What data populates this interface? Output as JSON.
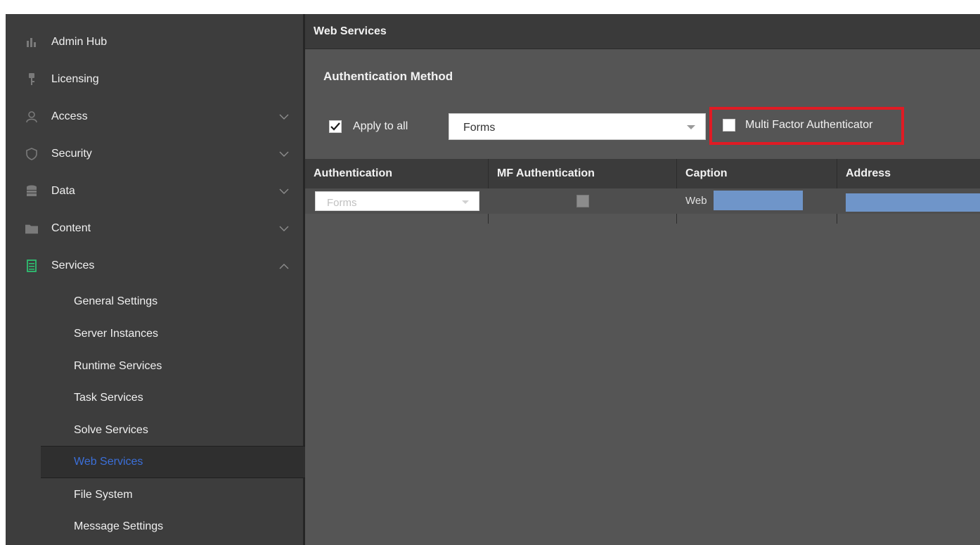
{
  "sidebar": {
    "items": [
      {
        "label": "Admin Hub",
        "icon": "admin-hub-icon"
      },
      {
        "label": "Licensing",
        "icon": "key-icon"
      },
      {
        "label": "Access",
        "icon": "user-icon",
        "expanded": false
      },
      {
        "label": "Security",
        "icon": "shield-icon",
        "expanded": false
      },
      {
        "label": "Data",
        "icon": "database-icon",
        "expanded": false
      },
      {
        "label": "Content",
        "icon": "folder-icon",
        "expanded": false
      },
      {
        "label": "Services",
        "icon": "services-icon",
        "expanded": true
      }
    ],
    "sub_items": [
      {
        "label": "General Settings"
      },
      {
        "label": "Server Instances"
      },
      {
        "label": "Runtime Services"
      },
      {
        "label": "Task Services"
      },
      {
        "label": "Solve Services"
      },
      {
        "label": "Web Services",
        "active": true
      },
      {
        "label": "File System"
      },
      {
        "label": "Message Settings"
      }
    ]
  },
  "main": {
    "header_title": "Web Services",
    "section_title": "Authentication Method",
    "apply_to_all": {
      "label": "Apply to all",
      "checked": true
    },
    "method_select": {
      "value": "Forms"
    },
    "mfa": {
      "label": "Multi Factor Authenticator",
      "checked": false,
      "highlight_color": "#e01b24"
    },
    "grid": {
      "columns": [
        "Authentication",
        "MF Authentication",
        "Caption",
        "Address"
      ],
      "rows": [
        {
          "authentication": "Forms",
          "mf_authentication": false,
          "caption": "Web"
        }
      ]
    }
  },
  "colors": {
    "active_link": "#3b6fd8",
    "redaction": "#6f95c9"
  }
}
